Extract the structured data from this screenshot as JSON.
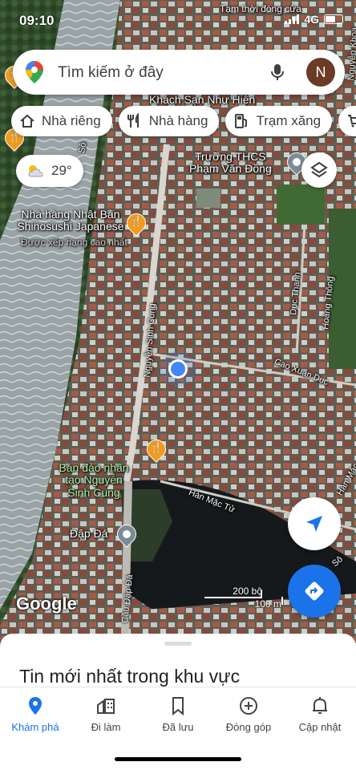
{
  "status_bar": {
    "time": "09:10",
    "network": "4G"
  },
  "search": {
    "placeholder": "Tìm kiếm ở đây",
    "avatar_letter": "N"
  },
  "chips": [
    {
      "label": "Nhà riêng",
      "icon": "home-icon"
    },
    {
      "label": "Nhà hàng",
      "icon": "restaurant-icon"
    },
    {
      "label": "Trạm xăng",
      "icon": "gas-station-icon"
    }
  ],
  "weather": {
    "temperature": "29°",
    "icon": "partly-cloudy-icon"
  },
  "map_labels": {
    "top_banner": "Tạm thời đóng cửa",
    "hotel": "Khách Sạn Như Hiên",
    "school_line1": "Trường THCS",
    "school_line2": "Phạm Văn Đồng",
    "restaurant_line1": "Nhà hàng Nhật Bản",
    "restaurant_line2": "Shinosushi Japanese",
    "restaurant_rating": "Được xếp hạng cao nhất",
    "peninsula_line1": "Bán đảo nhân",
    "peninsula_line2": "tạo Nguyễn",
    "peninsula_line3": "Sinh Cung",
    "dam": "Đập Đá",
    "street_nsc": "Nguyễn Sinh Cung",
    "street_cxd": "Cao Xuân Dục",
    "street_dt": "Dục Thanh",
    "street_ht": "Hoàng Thông",
    "street_hmt": "Hàn Mặc Tử",
    "street_cdd": "Cầu Đập Đá",
    "street_so": "Sô",
    "street_hm_edge": "Hàn Mặc",
    "street_nkh_edge": "Nguyễn Khoa",
    "river_edge": "Sô"
  },
  "map_scale": {
    "top": "200 bộ",
    "bottom": "100 m"
  },
  "brand": "Google",
  "bottom_sheet": {
    "title": "Tin mới nhất trong khu vực"
  },
  "tabs": [
    {
      "label": "Khám phá",
      "icon": "explore-pin-icon",
      "active": true
    },
    {
      "label": "Đi làm",
      "icon": "commute-icon",
      "active": false
    },
    {
      "label": "Đã lưu",
      "icon": "bookmark-icon",
      "active": false
    },
    {
      "label": "Đóng góp",
      "icon": "add-circle-icon",
      "active": false
    },
    {
      "label": "Cập nhật",
      "icon": "bell-icon",
      "active": false
    }
  ],
  "colors": {
    "accent": "#1a73e8",
    "avatar": "#6a3b26",
    "food_pin": "#f29a1c",
    "location_dot": "#4285f4"
  }
}
